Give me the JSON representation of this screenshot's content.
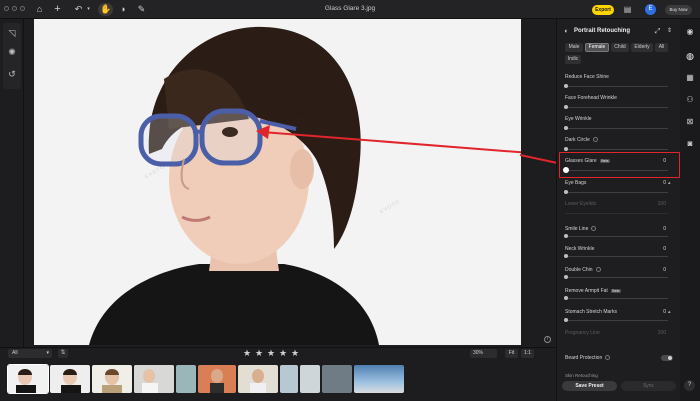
{
  "document": {
    "title": "Glass Glare 3.jpg"
  },
  "topbar": {
    "export_label": "Export",
    "avatar_initial": "E",
    "buynow_label": "Buy Now"
  },
  "filter": {
    "value": "All"
  },
  "rating": {
    "stars": 5
  },
  "zoom": {
    "value": "30%",
    "fit_label": "Fit",
    "one_to_one_label": "1:1"
  },
  "watermark": "EVOTO",
  "panel": {
    "title": "Portrait Retouching",
    "tags": [
      "Male",
      "Female",
      "Child",
      "Elderly",
      "All",
      "Indic"
    ],
    "active_tag": "Female",
    "sliders": [
      {
        "label": "Reduce Face Shine",
        "value": ""
      },
      {
        "label": "Face Forehead Wrinkle",
        "value": ""
      },
      {
        "label": "Eye Wrinkle",
        "value": ""
      },
      {
        "label": "Dark Circle",
        "value": ""
      },
      {
        "label": "Glasses Glare",
        "beta": "Beta",
        "value": "0"
      },
      {
        "label": "Eye Bags",
        "value": "0"
      },
      {
        "label": "Lower Eyelids",
        "value": "100"
      },
      {
        "label": "Smile Line",
        "value": "0"
      },
      {
        "label": "Neck Wrinkle",
        "value": "0"
      },
      {
        "label": "Double Chin",
        "value": "0"
      },
      {
        "label": "Remove Armpit Fat",
        "beta": "Beta",
        "value": ""
      },
      {
        "label": "Stomach Stretch Marks",
        "value": "0"
      },
      {
        "label": "Pregnancy Line",
        "value": "100"
      }
    ],
    "beard_protection_label": "Beard Protection",
    "skin_retouching_label": "Skin Retouching",
    "save_preset_label": "Save Preset",
    "sync_label": "Sync"
  },
  "colors": {
    "accent_yellow": "#ffd400",
    "highlight_red": "#e0262c",
    "avatar_blue": "#2f6fe0"
  }
}
